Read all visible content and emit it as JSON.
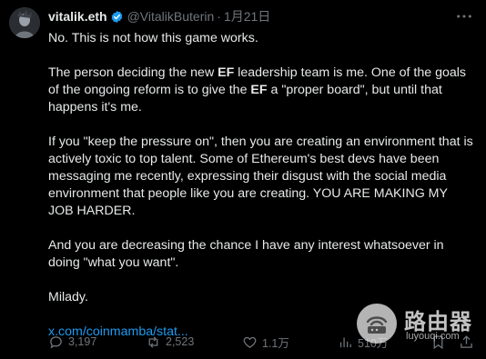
{
  "tweet": {
    "display_name": "vitalik.eth",
    "handle": "@VitalikButerin",
    "separator": "·",
    "date": "1月21日",
    "more_icon": "more-icon",
    "paragraphs": {
      "p1": "No. This is not how this game works.",
      "p2": {
        "a": "The person deciding the new ",
        "b": "EF",
        "c": " leadership team is me. One of the goals of the ongoing reform is to give the ",
        "d": "EF",
        "e": " a \"proper board\", but until that happens it's me."
      },
      "p3": "If you \"keep the pressure on\", then you are creating an environment that is actively toxic to top talent. Some of Ethereum's best devs have been messaging me recently, expressing their disgust with the social media environment that people like you are creating. YOU ARE MAKING MY JOB HARDER.",
      "p4": "And you are decreasing the chance I have any interest whatsoever in doing \"what you want\".",
      "p5": "Milady.",
      "link": "x.com/coinmamba/stat..."
    },
    "actions": {
      "replies": "3,197",
      "reposts": "2,523",
      "likes": "1.1万",
      "views": "510万"
    },
    "colors": {
      "background": "#000000",
      "text": "#e7e9ea",
      "muted": "#71767b",
      "link": "#1d9bf0",
      "verified": "#1d9bf0"
    }
  },
  "watermark": {
    "title": "路由器",
    "subtitle": "luyouqi.com"
  }
}
